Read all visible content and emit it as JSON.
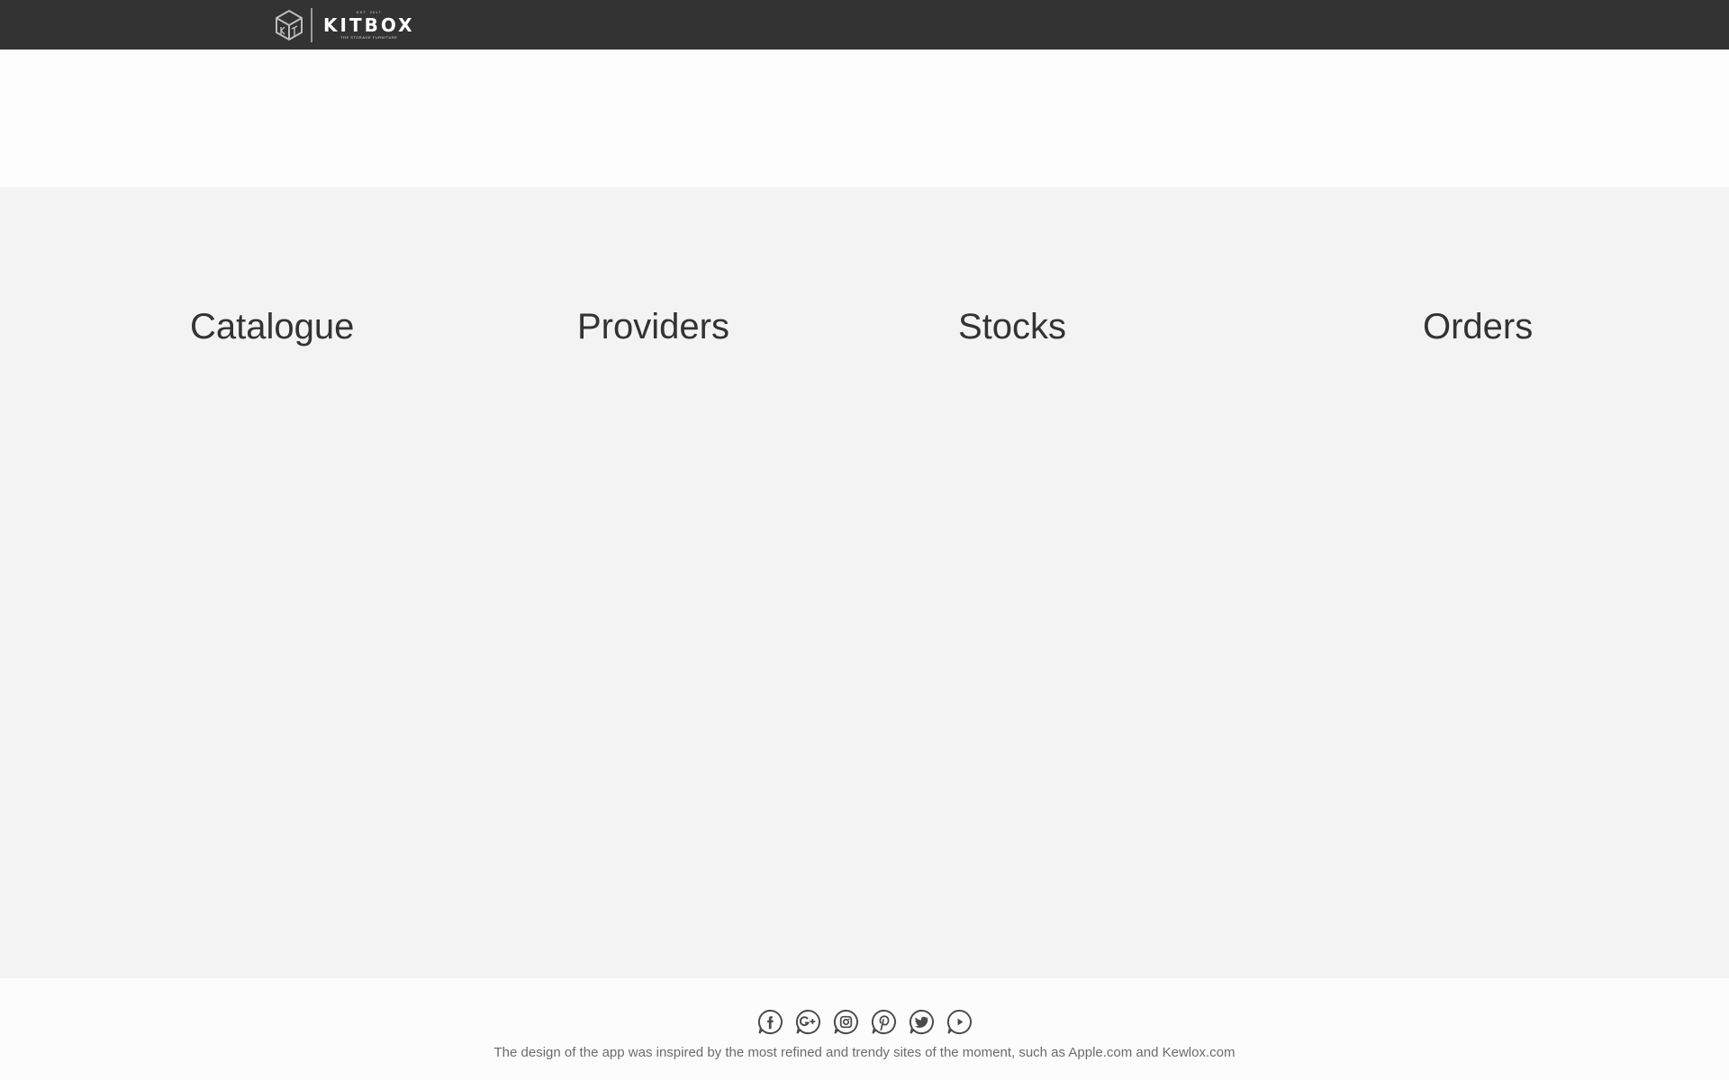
{
  "brand": {
    "est": "EST. 2017",
    "name": "KITBOX",
    "tagline": "THE STORAGE FURNITURE"
  },
  "sections": [
    {
      "label": "Catalogue"
    },
    {
      "label": "Providers"
    },
    {
      "label": "Stocks"
    },
    {
      "label": "Orders"
    }
  ],
  "footer": {
    "socials": [
      "facebook-icon",
      "google-plus-icon",
      "instagram-icon",
      "pinterest-icon",
      "twitter-icon",
      "youtube-icon"
    ],
    "credit_text": "The design of the app was inspired by the most refined and trendy sites of the moment, such as",
    "link_apple": "Apple.com",
    "and": "and",
    "link_kewlox": "Kewlox.com"
  },
  "colors": {
    "topbar": "#333333",
    "hero": "#fdfdfd",
    "main": "#f3f3f3",
    "icon": "#4a4a4a"
  }
}
